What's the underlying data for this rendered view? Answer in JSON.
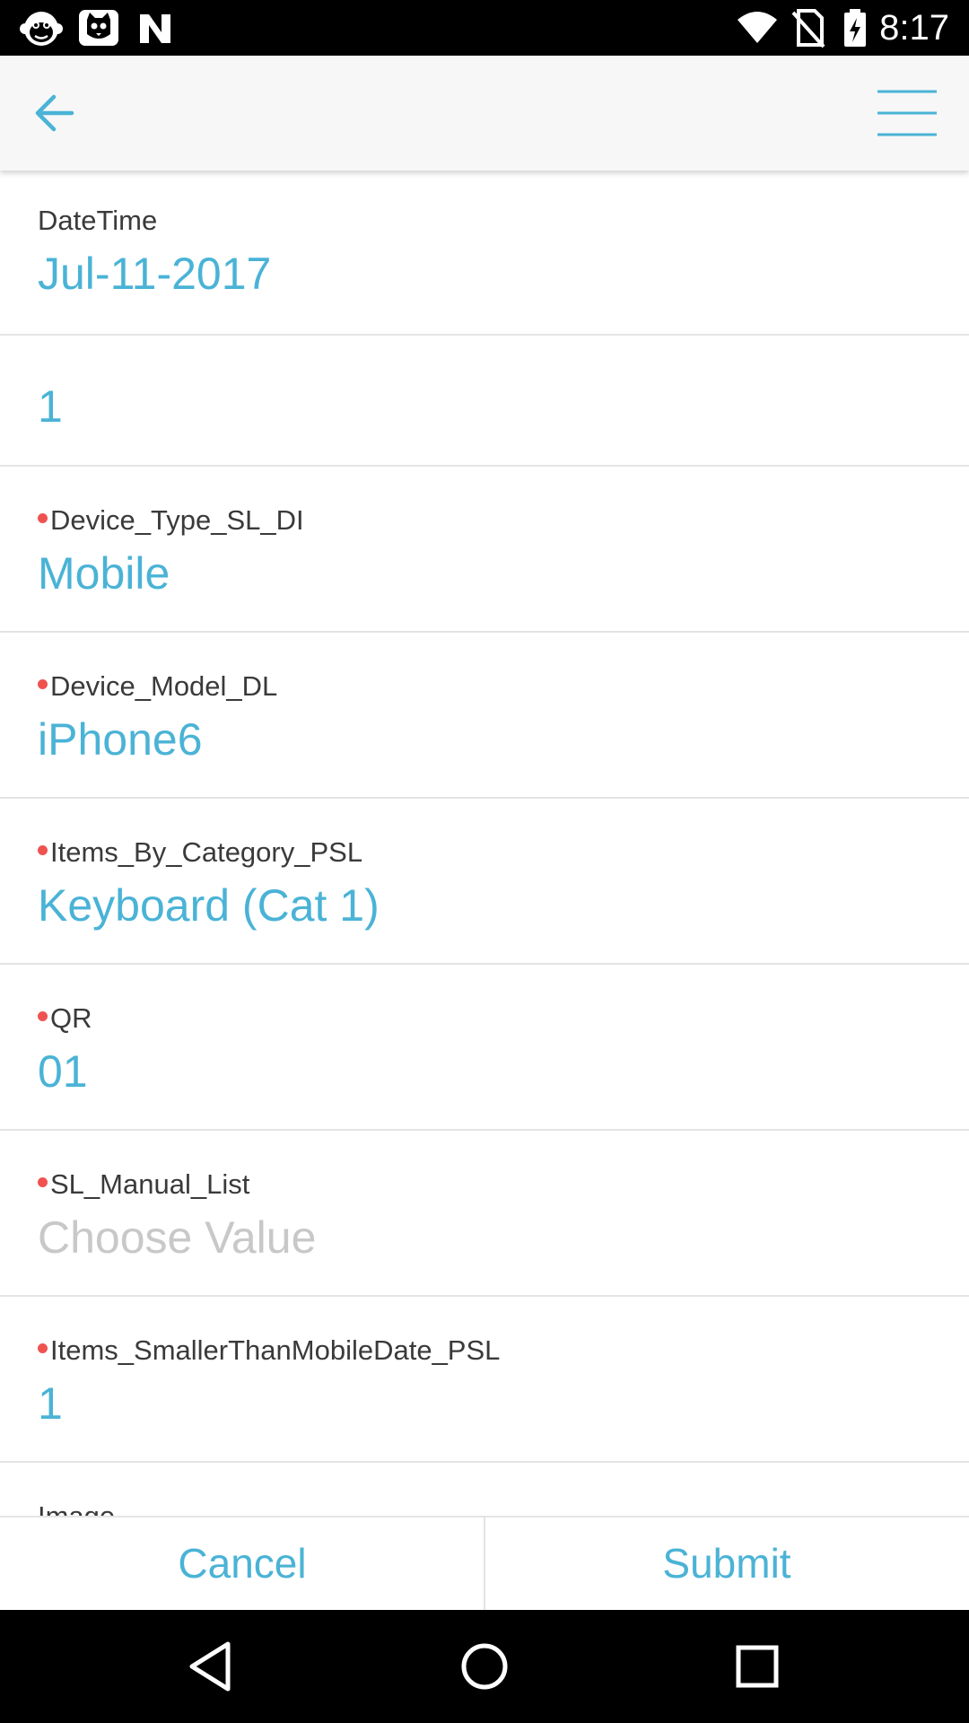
{
  "status_bar": {
    "time": "8:17",
    "icons": [
      "monkey-app-icon",
      "cat-app-icon",
      "n-app-icon",
      "wifi-icon",
      "no-sim-icon",
      "battery-charging-icon"
    ]
  },
  "app_bar": {
    "back_icon": "arrow-left-icon",
    "menu_icon": "hamburger-menu-icon",
    "accent_color": "#4ab3d6"
  },
  "form": {
    "fields": [
      {
        "label": "DateTime",
        "value": "Jul-11-2017",
        "required": false
      },
      {
        "label": "",
        "value": "1",
        "required": false
      },
      {
        "label": "Device_Type_SL_DI",
        "value": "Mobile",
        "required": true
      },
      {
        "label": "Device_Model_DL",
        "value": "iPhone6",
        "required": true
      },
      {
        "label": "Items_By_Category_PSL",
        "value": "Keyboard (Cat 1)",
        "required": true
      },
      {
        "label": "QR",
        "value": "01",
        "required": true
      },
      {
        "label": "SL_Manual_List",
        "placeholder": "Choose Value",
        "required": true
      },
      {
        "label": "Items_SmallerThanMobileDate_PSL",
        "value": "1",
        "required": true
      },
      {
        "label": "Image",
        "required": false
      }
    ],
    "required_color": "#ef5350"
  },
  "actions": {
    "cancel_label": "Cancel",
    "submit_label": "Submit"
  },
  "nav_bar": {
    "icons": [
      "back-triangle-icon",
      "home-circle-icon",
      "recents-square-icon"
    ]
  }
}
